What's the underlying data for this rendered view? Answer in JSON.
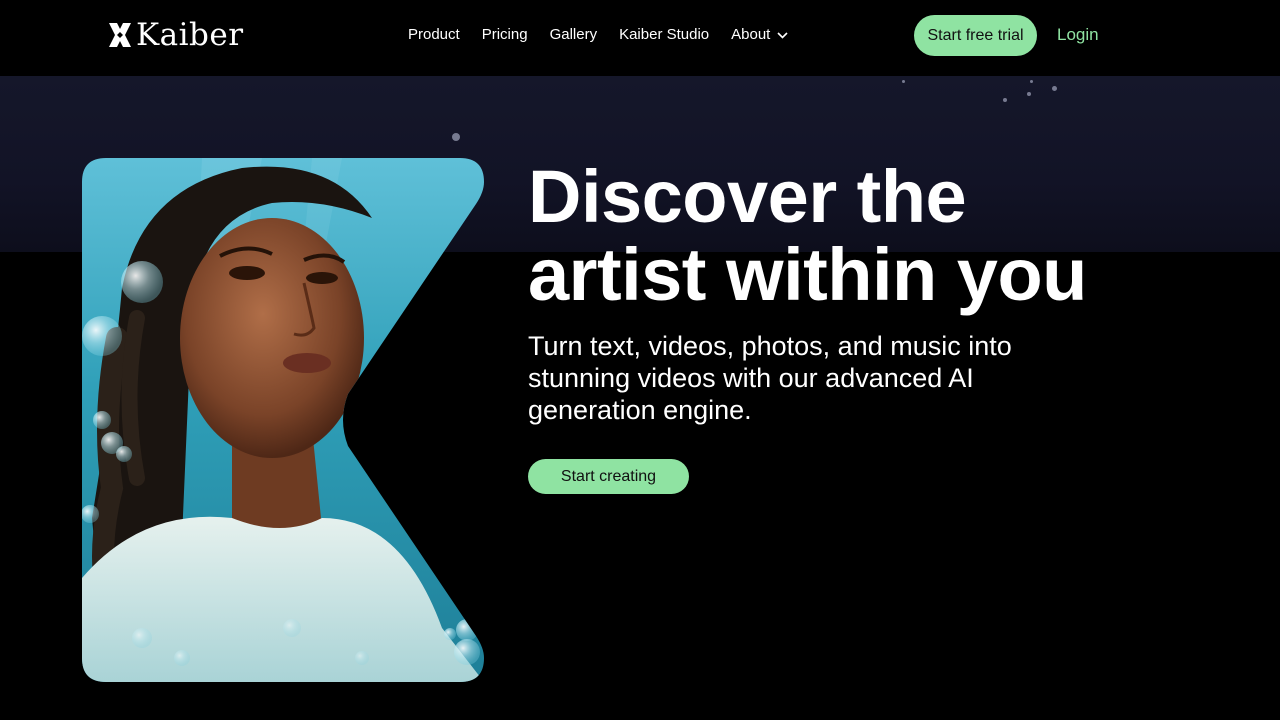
{
  "brand": {
    "name": "Kaiber",
    "logo_icon": "kaiber-k-logo-icon",
    "accent_color": "#8fe3a2",
    "background_color": "#000000"
  },
  "nav": {
    "links": [
      {
        "label": "Product"
      },
      {
        "label": "Pricing"
      },
      {
        "label": "Gallery"
      },
      {
        "label": "Kaiber Studio"
      },
      {
        "label": "About",
        "icon": "chevron-down-icon"
      }
    ],
    "cta_label": "Start free trial",
    "login_label": "Login"
  },
  "hero": {
    "headline_line1": "Discover the",
    "headline_line2": "artist within you",
    "subtext": "Turn text, videos, photos, and music into stunning videos with our advanced AI generation engine.",
    "cta_label": "Start creating",
    "image_icon": "underwater-portrait-artwork"
  }
}
